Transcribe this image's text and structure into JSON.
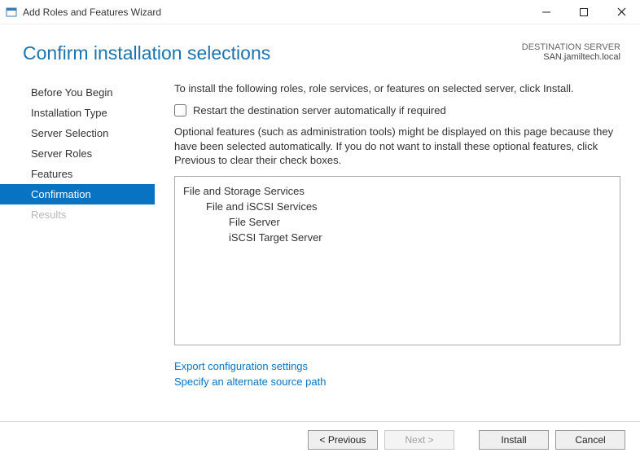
{
  "window": {
    "title": "Add Roles and Features Wizard"
  },
  "header": {
    "title": "Confirm installation selections",
    "destination_label": "DESTINATION SERVER",
    "destination_server": "SAN.jamiltech.local"
  },
  "sidebar": {
    "steps": [
      {
        "label": "Before You Begin",
        "selected": false,
        "disabled": false
      },
      {
        "label": "Installation Type",
        "selected": false,
        "disabled": false
      },
      {
        "label": "Server Selection",
        "selected": false,
        "disabled": false
      },
      {
        "label": "Server Roles",
        "selected": false,
        "disabled": false
      },
      {
        "label": "Features",
        "selected": false,
        "disabled": false
      },
      {
        "label": "Confirmation",
        "selected": true,
        "disabled": false
      },
      {
        "label": "Results",
        "selected": false,
        "disabled": true
      }
    ]
  },
  "main": {
    "intro": "To install the following roles, role services, or features on selected server, click Install.",
    "restart_label": "Restart the destination server automatically if required",
    "restart_checked": false,
    "optional_text": "Optional features (such as administration tools) might be displayed on this page because they have been selected automatically. If you do not want to install these optional features, click Previous to clear their check boxes.",
    "selections": [
      {
        "label": "File and Storage Services",
        "level": 0
      },
      {
        "label": "File and iSCSI Services",
        "level": 1
      },
      {
        "label": "File Server",
        "level": 2
      },
      {
        "label": "iSCSI Target Server",
        "level": 2
      }
    ],
    "links": {
      "export": "Export configuration settings",
      "alternate": "Specify an alternate source path"
    }
  },
  "footer": {
    "previous": "< Previous",
    "next": "Next >",
    "install": "Install",
    "cancel": "Cancel",
    "next_enabled": false
  }
}
